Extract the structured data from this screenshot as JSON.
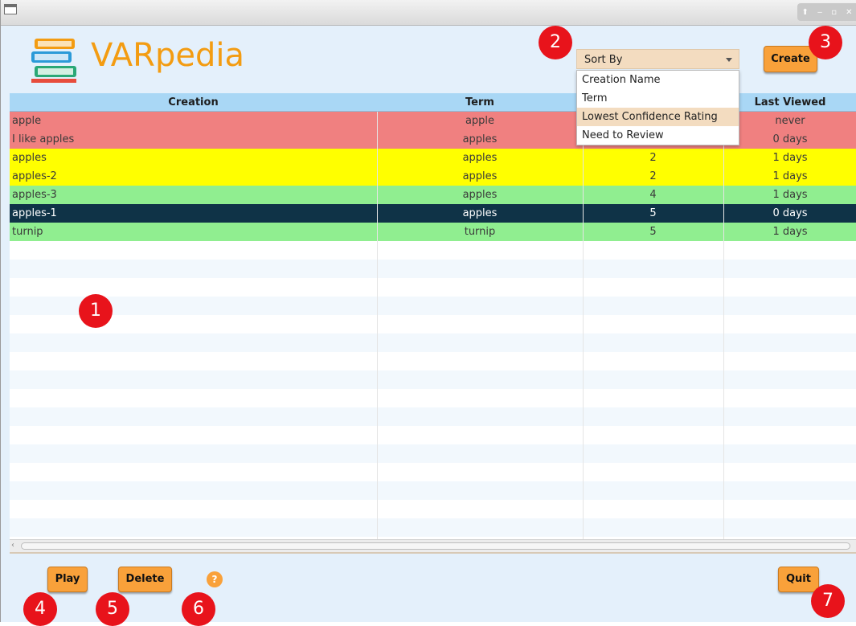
{
  "app": {
    "title": "VARpedia"
  },
  "sort": {
    "label": "Sort By",
    "options": [
      "Creation Name",
      "Term",
      "Lowest Confidence Rating",
      "Need to Review"
    ],
    "highlighted_index": 2
  },
  "buttons": {
    "create": "Create",
    "play": "Play",
    "delete": "Delete",
    "quit": "Quit",
    "help": "?"
  },
  "table": {
    "headers": [
      "Creation",
      "Term",
      "",
      "Last Viewed"
    ],
    "rows": [
      {
        "creation": "apple",
        "term": "apple",
        "rating": "",
        "last_viewed": "never",
        "color": "#f08080"
      },
      {
        "creation": "I like apples",
        "term": "apples",
        "rating": "",
        "last_viewed": "0 days",
        "color": "#f08080"
      },
      {
        "creation": "apples",
        "term": "apples",
        "rating": "2",
        "last_viewed": "1 days",
        "color": "#ffff00"
      },
      {
        "creation": "apples-2",
        "term": "apples",
        "rating": "2",
        "last_viewed": "1 days",
        "color": "#ffff00"
      },
      {
        "creation": "apples-3",
        "term": "apples",
        "rating": "4",
        "last_viewed": "1 days",
        "color": "#90ee90"
      },
      {
        "creation": "apples-1",
        "term": "apples",
        "rating": "5",
        "last_viewed": "0 days",
        "color": "#0f3347",
        "selected": true
      },
      {
        "creation": "turnip",
        "term": "turnip",
        "rating": "5",
        "last_viewed": "1 days",
        "color": "#90ee90"
      }
    ]
  },
  "annotations": [
    "1",
    "2",
    "3",
    "4",
    "5",
    "6",
    "7"
  ],
  "colors": {
    "accent": "#f9a13a",
    "header": "#a9d7f5",
    "badge": "#e8131b"
  }
}
